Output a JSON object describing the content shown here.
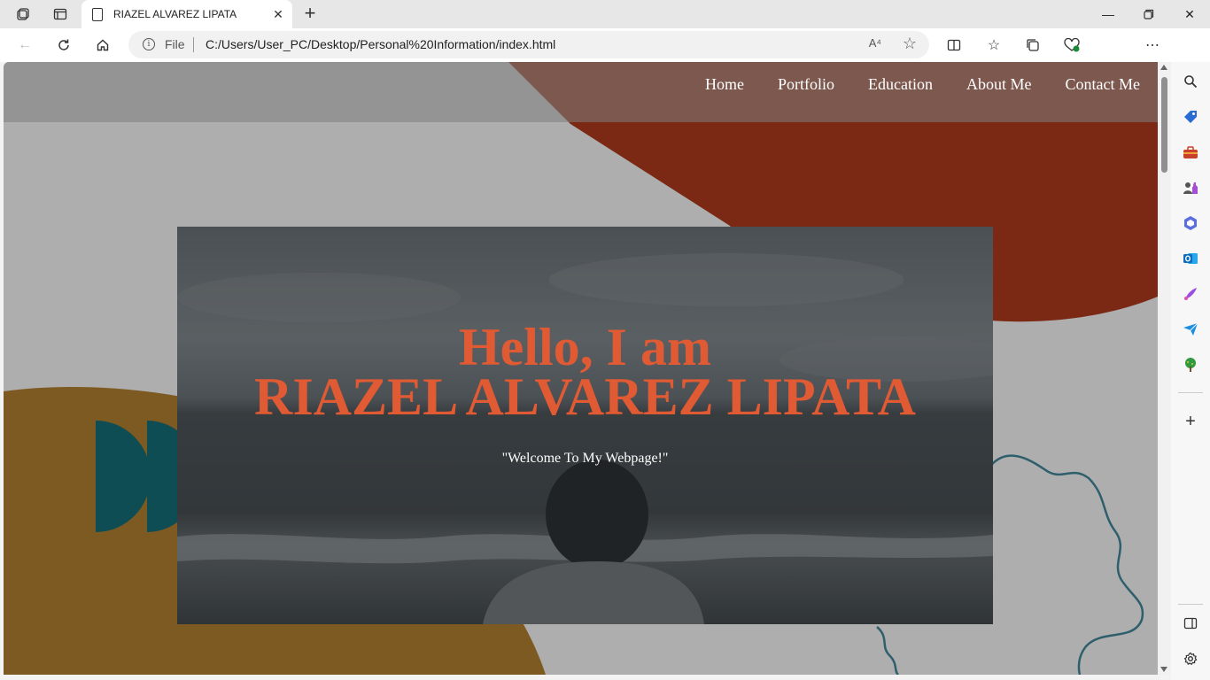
{
  "browser": {
    "tab_title": "RIAZEL ALVAREZ LIPATA",
    "address_scheme": "File",
    "address_url": "C:/Users/User_PC/Desktop/Personal%20Information/index.html",
    "read_aloud_label": "A⁴"
  },
  "page": {
    "nav": [
      "Home",
      "Portfolio",
      "Education",
      "About Me",
      "Contact Me"
    ],
    "hero": {
      "greeting": "Hello, I am",
      "name": "RIAZEL ALVAREZ LIPATA",
      "tagline": "\"Welcome To My Webpage!\""
    }
  },
  "colors": {
    "accent": "#e05a34",
    "deco_red": "#7b2914",
    "deco_gold": "#7d5a21",
    "deco_teal": "#0f4d55",
    "page_bg": "#aeaeae"
  },
  "icons": {
    "tabstrip": [
      "workspaces-icon",
      "vertical-tabs-icon",
      "page-icon",
      "close-icon",
      "new-tab-icon"
    ],
    "toolbar": [
      "back-icon",
      "refresh-icon",
      "home-icon",
      "info-icon",
      "read-aloud-icon",
      "favorite-star-icon",
      "split-screen-icon",
      "favorites-icon",
      "collections-icon",
      "browser-essentials-icon",
      "profile-avatar",
      "more-icon",
      "copilot-icon"
    ],
    "sidebar": [
      "search-icon",
      "shopping-icon",
      "tools-icon",
      "games-icon",
      "microsoft-365-icon",
      "outlook-icon",
      "designer-icon",
      "send-icon",
      "tree-icon",
      "add-icon",
      "sidebar-toggle-icon",
      "settings-icon"
    ]
  }
}
